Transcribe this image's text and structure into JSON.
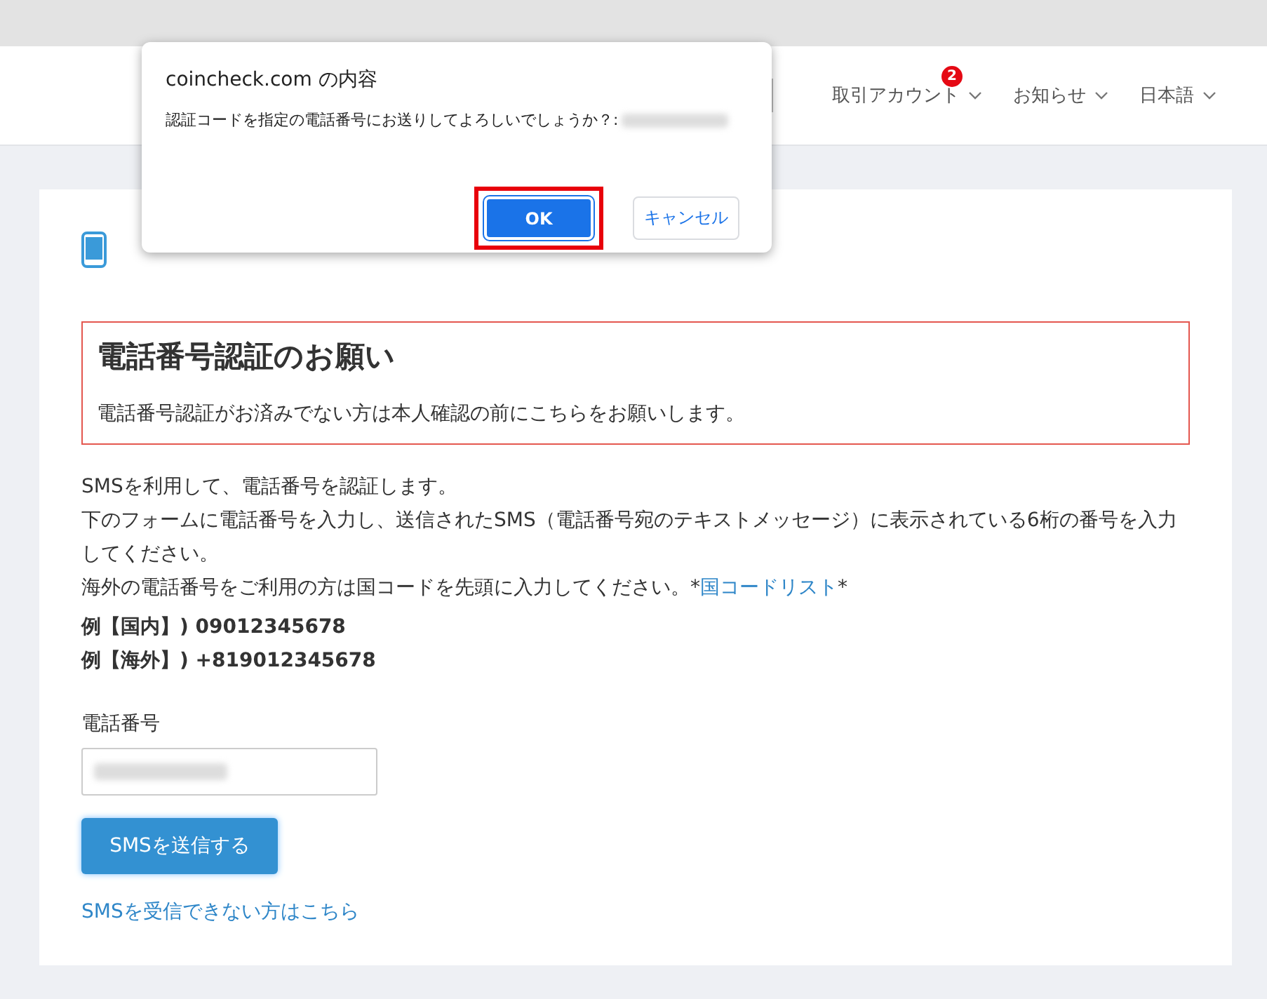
{
  "header": {
    "nav": [
      {
        "label": "取引アカウント",
        "badge": "2"
      },
      {
        "label": "お知らせ"
      },
      {
        "label": "日本語"
      }
    ]
  },
  "page": {
    "notice": {
      "title": "電話番号認証のお願い",
      "text": "電話番号認証がお済みでない方は本人確認の前にこちらをお願いします。"
    },
    "paragraphs": [
      "SMSを利用して、電話番号を認証します。",
      "下のフォームに電話番号を入力し、送信されたSMS（電話番号宛のテキストメッセージ）に表示されている6桁の番号を入力してください。"
    ],
    "country_note": {
      "text": "海外の電話番号をご利用の方は国コードを先頭に入力してください。*",
      "link": "国コードリスト",
      "after": "*"
    },
    "examples": [
      "例【国内】) 09012345678",
      "例【海外】) +819012345678"
    ],
    "phone_label": "電話番号",
    "submit_button": "SMSを送信する",
    "help_link": "SMSを受信できない方はこちら"
  },
  "dialog": {
    "title": "coincheck.com の内容",
    "message": "認証コードを指定の電話番号にお送りしてよろしいでしょうか？:",
    "buttons": [
      {
        "label": "OK",
        "kind": "primary",
        "highlighted": true
      },
      {
        "label": "キャンセル",
        "kind": "secondary",
        "highlighted": false
      }
    ]
  }
}
